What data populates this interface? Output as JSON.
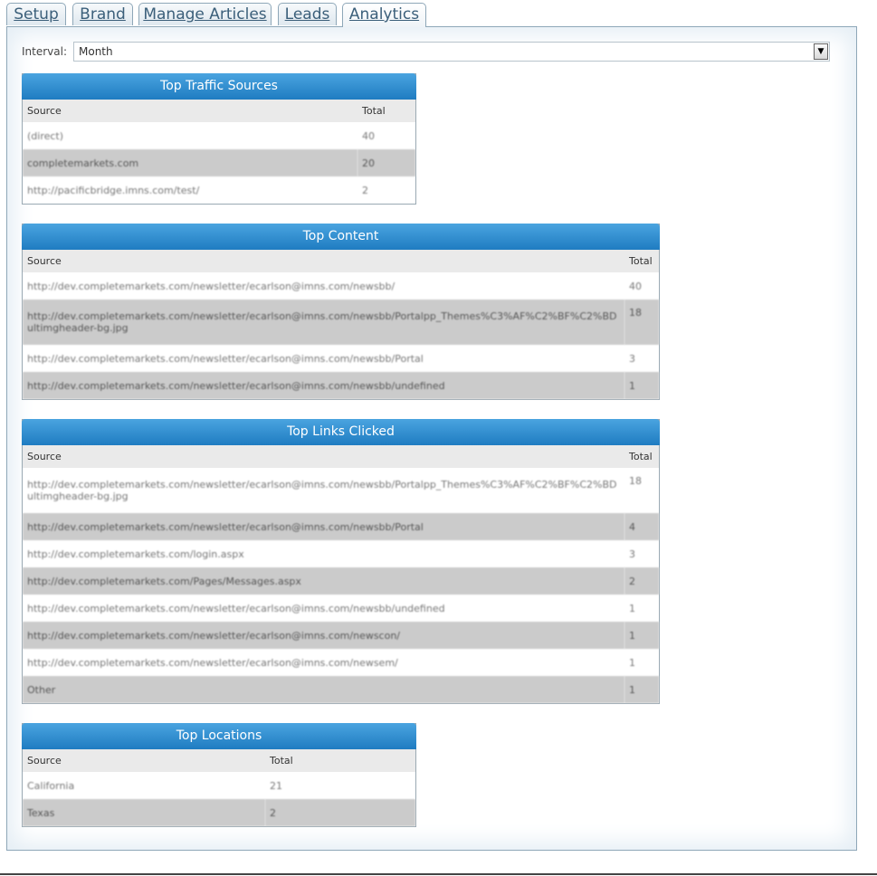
{
  "tabs": [
    "Setup",
    "Brand",
    "Manage Articles",
    "Leads",
    "Analytics"
  ],
  "active_tab": "Analytics",
  "interval": {
    "label": "Interval:",
    "value": "Month"
  },
  "top_traffic": {
    "title": "Top Traffic Sources",
    "headers": [
      "Source",
      "Total"
    ],
    "rows": [
      [
        "(direct)",
        "40"
      ],
      [
        "completemarkets.com",
        "20"
      ],
      [
        "http://pacificbridge.imns.com/test/",
        "2"
      ]
    ]
  },
  "top_content": {
    "title": "Top Content",
    "headers": [
      "Source",
      "Total"
    ],
    "rows": [
      [
        "http://dev.completemarkets.com/newsletter/ecarlson@imns.com/newsbb/",
        "40"
      ],
      [
        "http://dev.completemarkets.com/newsletter/ecarlson@imns.com/newsbb/Portalpp_Themes%C3%AF%C2%BF%C2%BDultimgheader-bg.jpg",
        "18"
      ],
      [
        "http://dev.completemarkets.com/newsletter/ecarlson@imns.com/newsbb/Portal",
        "3"
      ],
      [
        "http://dev.completemarkets.com/newsletter/ecarlson@imns.com/newsbb/undefined",
        "1"
      ]
    ]
  },
  "top_links": {
    "title": "Top Links Clicked",
    "headers": [
      "Source",
      "Total"
    ],
    "rows": [
      [
        "http://dev.completemarkets.com/newsletter/ecarlson@imns.com/newsbb/Portalpp_Themes%C3%AF%C2%BF%C2%BDultimgheader-bg.jpg",
        "18"
      ],
      [
        "http://dev.completemarkets.com/newsletter/ecarlson@imns.com/newsbb/Portal",
        "4"
      ],
      [
        "http://dev.completemarkets.com/login.aspx",
        "3"
      ],
      [
        "http://dev.completemarkets.com/Pages/Messages.aspx",
        "2"
      ],
      [
        "http://dev.completemarkets.com/newsletter/ecarlson@imns.com/newsbb/undefined",
        "1"
      ],
      [
        "http://dev.completemarkets.com/newsletter/ecarlson@imns.com/newscon/",
        "1"
      ],
      [
        "http://dev.completemarkets.com/newsletter/ecarlson@imns.com/newsem/",
        "1"
      ],
      [
        "Other",
        "1"
      ]
    ]
  },
  "top_locations": {
    "title": "Top Locations",
    "headers": [
      "Source",
      "Total"
    ],
    "rows": [
      [
        "California",
        "21"
      ],
      [
        "Texas",
        "2"
      ]
    ]
  }
}
